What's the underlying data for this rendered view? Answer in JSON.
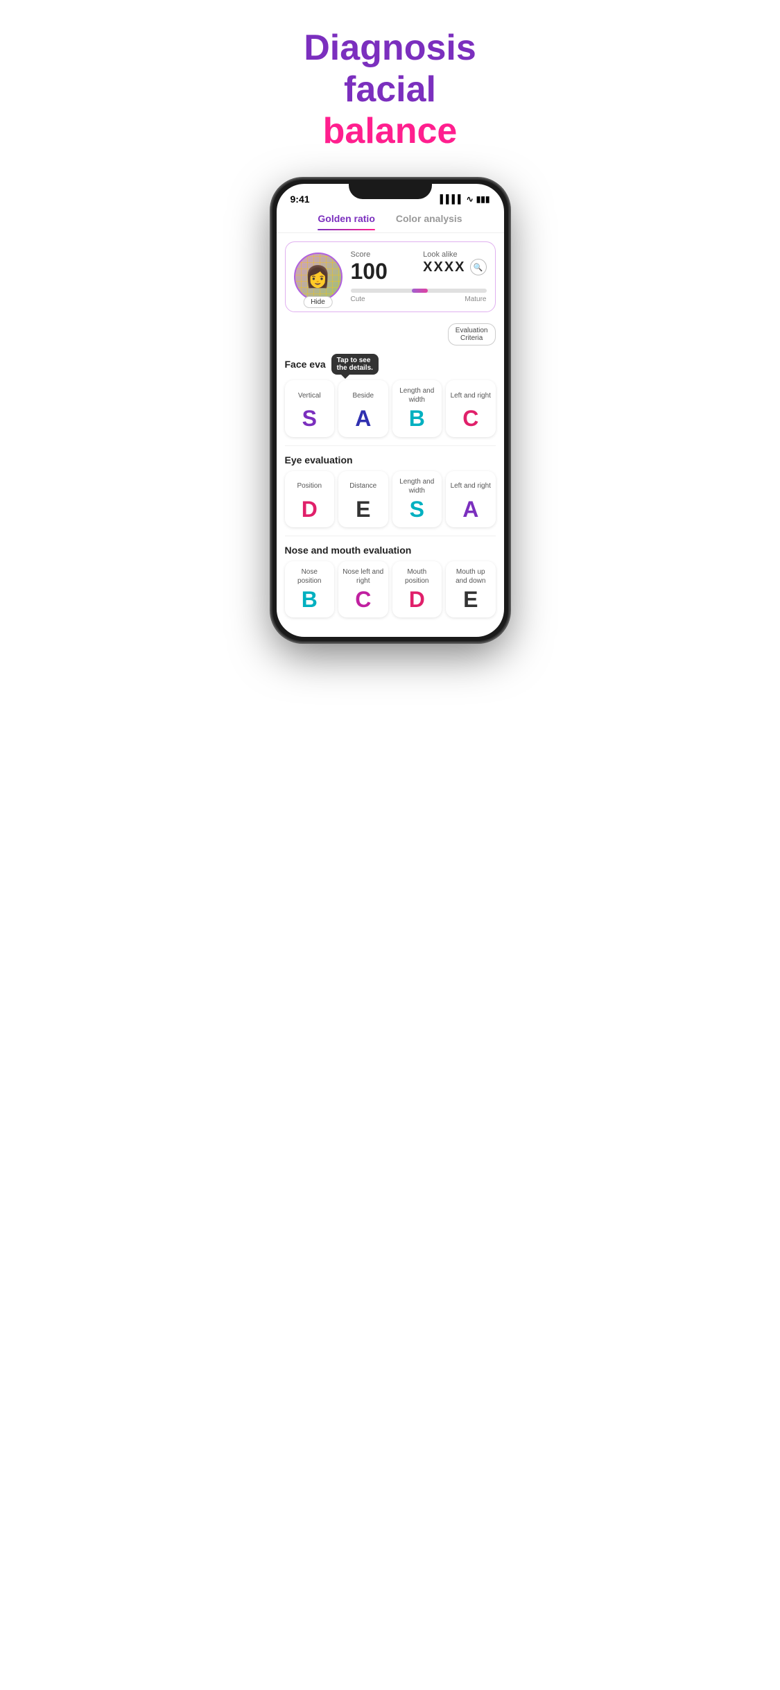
{
  "hero": {
    "line1_purple": "Diagnosis facial",
    "line2_pink": "balance"
  },
  "phone": {
    "status_time": "9:41",
    "tabs": [
      {
        "id": "golden",
        "label": "Golden ratio",
        "active": true
      },
      {
        "id": "color",
        "label": "Color analysis",
        "active": false
      }
    ],
    "score_card": {
      "score_label": "Score",
      "score_value": "100",
      "look_alike_label": "Look alike",
      "look_alike_name": "XXXX",
      "hide_btn": "Hide",
      "slider_left": "Cute",
      "slider_right": "Mature"
    },
    "eval_criteria_btn": "Evaluation\nCriteria",
    "face_eval": {
      "title": "Face eva",
      "tooltip": "Tap to see\nthe details.",
      "grades": [
        {
          "label": "Vertical",
          "letter": "S",
          "color": "grade-purple"
        },
        {
          "label": "Beside",
          "letter": "A",
          "color": "grade-darkblue"
        },
        {
          "label": "Length and width",
          "letter": "B",
          "color": "grade-cyan"
        },
        {
          "label": "Left and right",
          "letter": "C",
          "color": "grade-pink"
        }
      ]
    },
    "eye_eval": {
      "title": "Eye evaluation",
      "grades": [
        {
          "label": "Position",
          "letter": "D",
          "color": "grade-pink"
        },
        {
          "label": "Distance",
          "letter": "E",
          "color": "grade-dark"
        },
        {
          "label": "Length and width",
          "letter": "S",
          "color": "grade-cyan"
        },
        {
          "label": "Left and right",
          "letter": "A",
          "color": "grade-purple"
        }
      ]
    },
    "nose_mouth_eval": {
      "title": "Nose and mouth evaluation",
      "grades": [
        {
          "label": "Nose position",
          "letter": "B",
          "color": "grade-cyan"
        },
        {
          "label": "Nose left and right",
          "letter": "C",
          "color": "grade-magenta"
        },
        {
          "label": "Mouth position",
          "letter": "D",
          "color": "grade-pink"
        },
        {
          "label": "Mouth up and down",
          "letter": "E",
          "color": "grade-dark"
        }
      ]
    }
  }
}
